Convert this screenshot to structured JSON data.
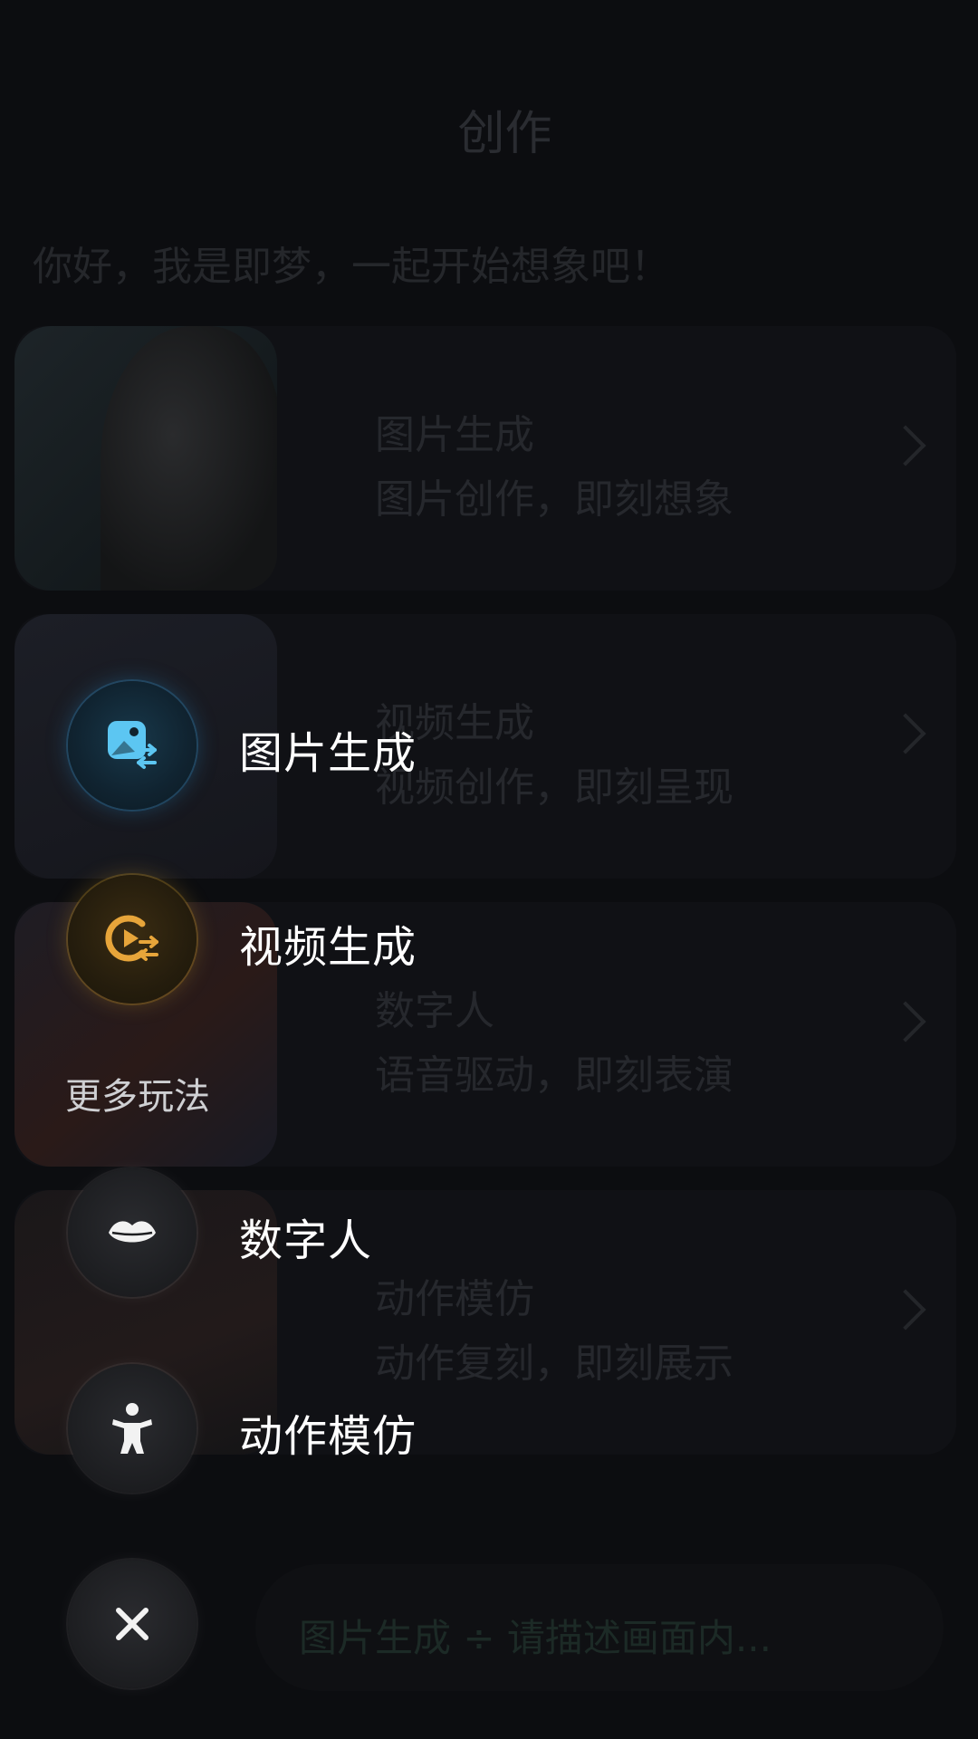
{
  "background_page": {
    "title": "创作",
    "greeting": "你好，我是即梦，一起开始想象吧！",
    "cards": [
      {
        "title": "图片生成",
        "subtitle": "图片创作，即刻想象"
      },
      {
        "title": "视频生成",
        "subtitle": "视频创作，即刻呈现"
      },
      {
        "title": "数字人",
        "subtitle": "语音驱动，即刻表演"
      },
      {
        "title": "动作模仿",
        "subtitle": "动作复刻，即刻展示"
      }
    ],
    "prompt_bar": {
      "text": "图片生成 ÷  请描述画面内..."
    }
  },
  "menu": {
    "primary": [
      {
        "label": "图片生成",
        "icon": "image-generate-icon",
        "accent": "#5cc6f2"
      },
      {
        "label": "视频生成",
        "icon": "video-generate-icon",
        "accent": "#e7a53a"
      }
    ],
    "section_label": "更多玩法",
    "more": [
      {
        "label": "数字人",
        "icon": "lips-icon"
      },
      {
        "label": "动作模仿",
        "icon": "person-pose-icon"
      }
    ],
    "close_icon": "close-icon"
  }
}
